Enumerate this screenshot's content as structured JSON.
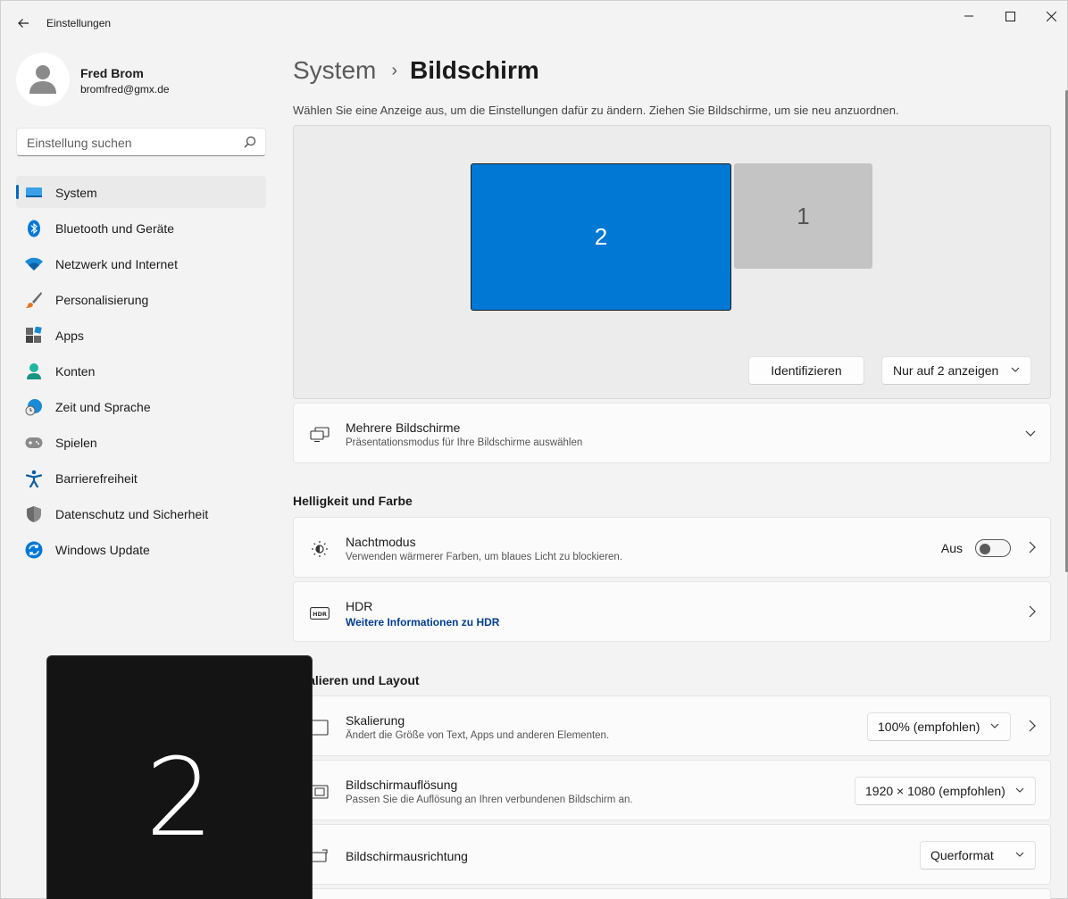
{
  "app": {
    "title": "Einstellungen"
  },
  "profile": {
    "name": "Fred Brom",
    "email": "bromfred@gmx.de"
  },
  "search": {
    "placeholder": "Einstellung suchen"
  },
  "nav": [
    {
      "label": "System",
      "icon": "monitor-icon",
      "active": true
    },
    {
      "label": "Bluetooth und Geräte",
      "icon": "bluetooth-icon"
    },
    {
      "label": "Netzwerk und Internet",
      "icon": "wifi-icon"
    },
    {
      "label": "Personalisierung",
      "icon": "brush-icon"
    },
    {
      "label": "Apps",
      "icon": "apps-icon"
    },
    {
      "label": "Konten",
      "icon": "account-icon"
    },
    {
      "label": "Zeit und Sprache",
      "icon": "globe-clock-icon"
    },
    {
      "label": "Spielen",
      "icon": "gamepad-icon"
    },
    {
      "label": "Barrierefreiheit",
      "icon": "accessibility-icon"
    },
    {
      "label": "Datenschutz und Sicherheit",
      "icon": "shield-icon"
    },
    {
      "label": "Windows Update",
      "icon": "update-icon"
    }
  ],
  "breadcrumb": {
    "parent": "System",
    "separator": "›",
    "current": "Bildschirm"
  },
  "intro": "Wählen Sie eine Anzeige aus, um die Einstellungen dafür zu ändern. Ziehen Sie Bildschirme, um sie neu anzuordnen.",
  "arrangement": {
    "monitor_selected": "2",
    "monitor_other": "1",
    "identify_label": "Identifizieren",
    "display_mode": "Nur auf 2 anzeigen"
  },
  "multi_display": {
    "title": "Mehrere Bildschirme",
    "subtitle": "Präsentationsmodus für Ihre Bildschirme auswählen"
  },
  "sections": {
    "brightness": "Helligkeit und Farbe",
    "scale": "Skalieren und Layout"
  },
  "night_mode": {
    "title": "Nachtmodus",
    "subtitle": "Verwenden wärmerer Farben, um blaues Licht zu blockieren.",
    "state": "Aus",
    "enabled": false
  },
  "hdr": {
    "title": "HDR",
    "link": "Weitere Informationen zu HDR"
  },
  "scaling": {
    "title": "Skalierung",
    "subtitle": "Ändert die Größe von Text, Apps und anderen Elementen.",
    "value": "100% (empfohlen)"
  },
  "resolution": {
    "title": "Bildschirmauflösung",
    "subtitle": "Passen Sie die Auflösung an Ihren verbundenen Bildschirm an.",
    "value": "1920 × 1080 (empfohlen)"
  },
  "orientation": {
    "title": "Bildschirmausrichtung",
    "value": "Querformat"
  },
  "identify_overlay": {
    "number": "2"
  },
  "colors": {
    "accent": "#0078d4",
    "background": "#f3f3f3"
  }
}
